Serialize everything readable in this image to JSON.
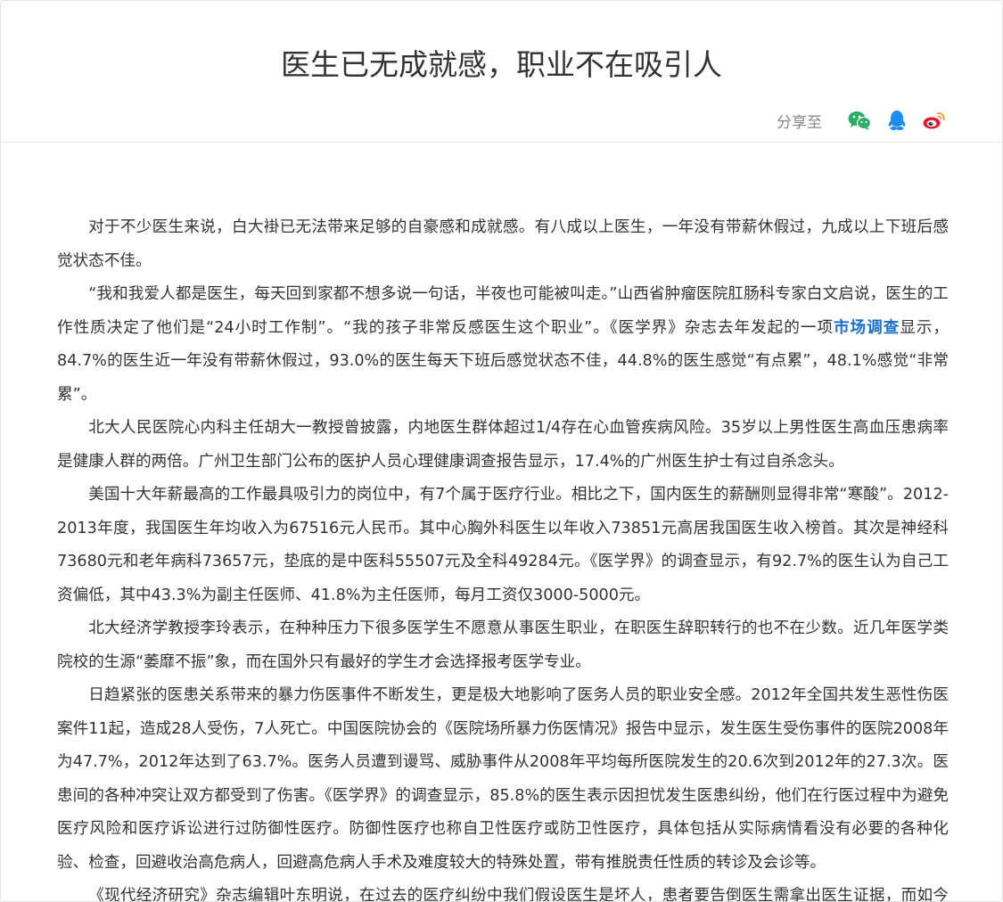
{
  "article": {
    "title": "医生已无成就感，职业不在吸引人",
    "share": {
      "label": "分享至",
      "icons": [
        "wechat-icon",
        "qq-icon",
        "weibo-icon"
      ],
      "colors": {
        "wechat": "#2aae67",
        "qq": "#1c8ef0",
        "weibo": "#e6162d"
      }
    },
    "paragraphs": [
      {
        "text": "对于不少医生来说，白大褂已无法带来足够的自豪感和成就感。有八成以上医生，一年没有带薪休假过，九成以上下班后感觉状态不佳。"
      },
      {
        "before": "“我和我爱人都是医生，每天回到家都不想多说一句话，半夜也可能被叫走。”山西省肿瘤医院肛肠科专家白文启说，医生的工作性质决定了他们是“24小时工作制”。“我的孩子非常反感医生这个职业”。《医学界》杂志去年发起的一项",
        "link": "市场调查",
        "after": "显示，84.7%的医生近一年没有带薪休假过，93.0%的医生每天下班后感觉状态不佳，44.8%的医生感觉“有点累”，48.1%感觉“非常累”。",
        "link_color": "#1a6fcf"
      },
      {
        "text": "北大人民医院心内科主任胡大一教授曾披露，内地医生群体超过1/4存在心血管疾病风险。35岁以上男性医生高血压患病率是健康人群的两倍。广州卫生部门公布的医护人员心理健康调查报告显示，17.4%的广州医生护士有过自杀念头。"
      },
      {
        "text": "美国十大年薪最高的工作最具吸引力的岗位中，有7个属于医疗行业。相比之下，国内医生的薪酬则显得非常“寒酸”。2012-2013年度，我国医生年均收入为67516元人民币。其中心胸外科医生以年收入73851元高居我国医生收入榜首。其次是神经科73680元和老年病科73657元，垫底的是中医科55507元及全科49284元。《医学界》的调查显示，有92.7%的医生认为自己工资偏低，其中43.3%为副主任医师、41.8%为主任医师，每月工资仅3000-5000元。"
      },
      {
        "text": "北大经济学教授李玲表示，在种种压力下很多医学生不愿意从事医生职业，在职医生辞职转行的也不在少数。近几年医学类院校的生源“萎靡不振”象，而在国外只有最好的学生才会选择报考医学专业。"
      },
      {
        "text": "日趋紧张的医患关系带来的暴力伤医事件不断发生，更是极大地影响了医务人员的职业安全感。2012年全国共发生恶性伤医案件11起，造成28人受伤，7人死亡。中国医院协会的《医院场所暴力伤医情况》报告中显示，发生医生受伤事件的医院2008年为47.7%，2012年达到了63.7%。医务人员遭到谩骂、威胁事件从2008年平均每所医院发生的20.6次到2012年的27.3次。医患间的各种冲突让双方都受到了伤害。《医学界》的调查显示，85.8%的医生表示因担忧发生医患纠纷，他们在行医过程中为避免医疗风险和医疗诉讼进行过防御性医疗。防御性医疗也称自卫性医疗或防卫性医疗，具体包括从实际病情看没有必要的各种化验、检查，回避收治高危病人，回避高危病人手术及难度较大的特殊处置，带有推脱责任性质的转诊及会诊等。"
      },
      {
        "text": "《现代经济研究》杂志编辑叶东明说，在过去的医疗纠纷中我们假设医生是坏人，患者要告倒医生需拿出医生证据，而如今的"
      }
    ]
  }
}
